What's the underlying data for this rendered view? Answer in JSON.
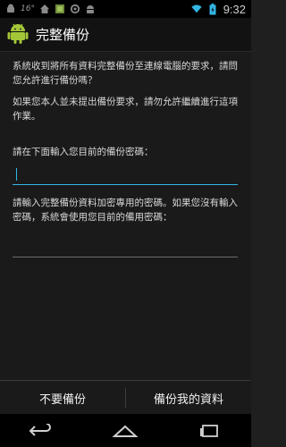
{
  "status_bar": {
    "temperature": "16°",
    "time": "9:32",
    "icons": [
      "android-icon",
      "temperature-text",
      "home-icon",
      "app-icon",
      "sync-icon",
      "android-icon",
      "wifi-icon",
      "battery-icon"
    ]
  },
  "action_bar": {
    "title": "完整備份"
  },
  "content": {
    "paragraph1": "系統收到將所有資料完整備份至連線電腦的要求，請問您允許進行備份嗎？",
    "paragraph2": "如果您本人並未提出備份要求，請勿允許繼續進行這項作業。",
    "current_password_label": "請在下面輸入您目前的備份密碼：",
    "current_password_value": "",
    "encryption_label": "請輸入完整備份資料加密專用的密碼。如果您沒有輸入密碼，系統會使用您目前的備用密碼：",
    "encryption_value": ""
  },
  "buttons": {
    "deny": "不要備份",
    "allow": "備份我的資料"
  },
  "colors": {
    "accent": "#33b5e5",
    "android_green": "#a4c639"
  }
}
